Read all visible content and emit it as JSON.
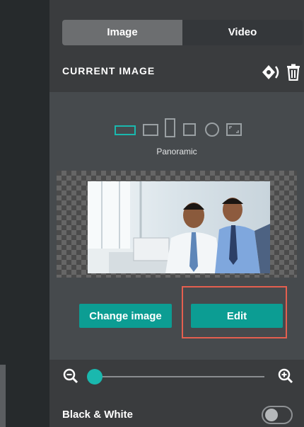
{
  "tabs": [
    {
      "label": "Image",
      "active": true
    },
    {
      "label": "Video",
      "active": false
    }
  ],
  "section": {
    "title": "CURRENT IMAGE",
    "icons": [
      "focal-point-icon",
      "trash-icon"
    ]
  },
  "shape_options": {
    "selected": "Panoramic",
    "icons": [
      "panoramic-shape-icon",
      "landscape-shape-icon",
      "portrait-shape-icon",
      "square-shape-icon",
      "circle-shape-icon",
      "original-shape-icon"
    ]
  },
  "buttons": {
    "change_image": "Change image",
    "edit": "Edit"
  },
  "zoom": {
    "value_fraction": 0.04,
    "icons": [
      "zoom-out-icon",
      "zoom-in-icon"
    ]
  },
  "black_white": {
    "label": "Black & White",
    "enabled": false
  },
  "colors": {
    "accent": "#1ab8ae",
    "button": "#0c9d93",
    "highlight": "#e45f4f"
  }
}
